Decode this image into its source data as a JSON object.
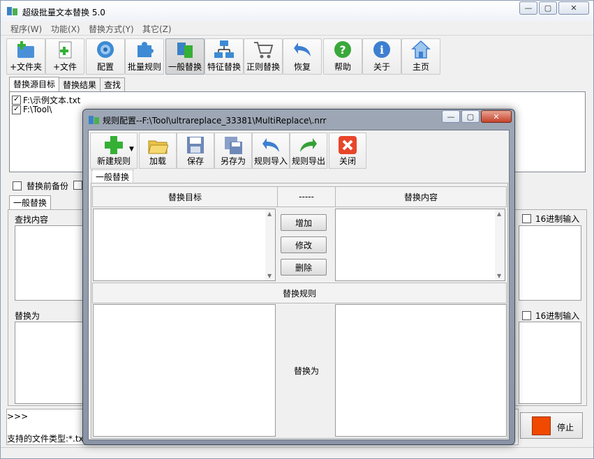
{
  "window": {
    "title": "超级批量文本替换 5.0",
    "min_glyph": "—",
    "max_glyph": "▢",
    "close_glyph": "✕"
  },
  "menu": {
    "items": [
      "程序(W)",
      "功能(X)",
      "替换方式(Y)",
      "其它(Z)"
    ]
  },
  "toolbar": {
    "buttons": [
      {
        "label": "+文件夹",
        "icon": "add-folder-icon"
      },
      {
        "label": "+文件",
        "icon": "add-file-icon"
      },
      {
        "label": "配置",
        "icon": "config-gear-icon"
      },
      {
        "label": "批量规则",
        "icon": "puzzle-icon"
      },
      {
        "label": "一般替换",
        "icon": "replace-icon"
      },
      {
        "label": "特征替换",
        "icon": "network-icon"
      },
      {
        "label": "正则替换",
        "icon": "cart-icon"
      },
      {
        "label": "恢复",
        "icon": "undo-arrow-icon"
      },
      {
        "label": "帮助",
        "icon": "help-icon"
      },
      {
        "label": "关于",
        "icon": "info-icon"
      },
      {
        "label": "主页",
        "icon": "home-icon"
      }
    ]
  },
  "source_tabs": [
    "替换源目标",
    "替换结果",
    "查找"
  ],
  "file_list": [
    "F:\\示例文本.txt",
    "F:\\Tool\\"
  ],
  "options": {
    "backup_label": "替换前备份"
  },
  "replace_tab": "一般替换",
  "find": {
    "label": "查找内容",
    "hex_label": "16进制输入"
  },
  "replace": {
    "label": "替换为",
    "hex_label": "16进制输入"
  },
  "status": {
    "prompt": ">>>",
    "file_types": "支持的文件类型:*.txt"
  },
  "stop_button": "停止",
  "dialog": {
    "title": "规则配置--F:\\Tool\\ultrareplace_33381\\MultiReplace\\.nrr",
    "toolbar": [
      {
        "label": "新建规则",
        "icon": "plus-icon"
      },
      {
        "label": "加载",
        "icon": "open-folder-icon"
      },
      {
        "label": "保存",
        "icon": "save-icon"
      },
      {
        "label": "另存为",
        "icon": "save-as-icon"
      },
      {
        "label": "规则导入",
        "icon": "import-icon"
      },
      {
        "label": "规则导出",
        "icon": "export-icon"
      },
      {
        "label": "关闭",
        "icon": "close-red-icon"
      }
    ],
    "tab": "一般替换",
    "col_target": "替换目标",
    "col_mid": "-----",
    "col_content": "替换内容",
    "add_btn": "增加",
    "edit_btn": "修改",
    "delete_btn": "删除",
    "rules_header": "替换规则",
    "replace_to": "替换为"
  }
}
